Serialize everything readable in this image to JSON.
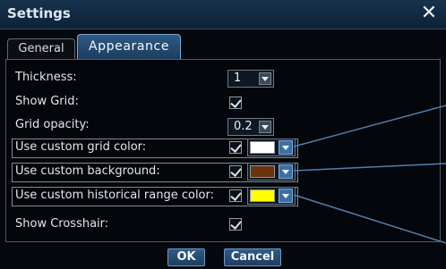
{
  "window": {
    "title": "Settings",
    "close_symbol": "✕"
  },
  "tabs": [
    {
      "label": "General",
      "active": false
    },
    {
      "label": "Appearance",
      "active": true
    }
  ],
  "settings": {
    "thickness": {
      "label": "Thickness:",
      "value": "1"
    },
    "show_grid": {
      "label": "Show Grid:",
      "checked": true
    },
    "grid_opacity": {
      "label": "Grid opacity:",
      "value": "0.2"
    },
    "custom_grid_color": {
      "label": "Use custom grid color:",
      "checked": true,
      "color": "#ffffff"
    },
    "custom_background": {
      "label": "Use custom background:",
      "checked": true,
      "color": "#6b3310"
    },
    "custom_historical_range_color": {
      "label": "Use custom historical range color:",
      "checked": true,
      "color": "#ffff00"
    },
    "show_crosshair": {
      "label": "Show Crosshair:",
      "checked": true
    }
  },
  "buttons": {
    "ok": "OK",
    "cancel": "Cancel"
  },
  "colors": {
    "titlebar": "#17324e",
    "accent": "#3b6fa5",
    "callout_line": "#4f7fb0"
  }
}
